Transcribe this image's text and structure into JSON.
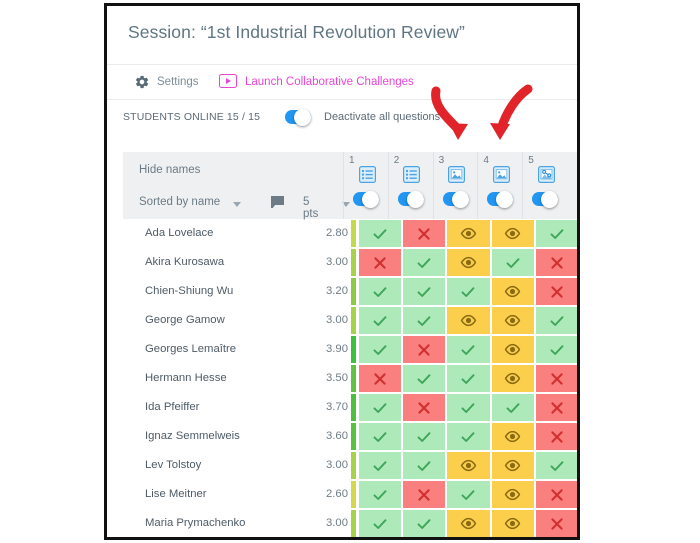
{
  "panel": {
    "title": "Session: “1st Industrial Revolution Review”",
    "accent_magenta": "#e846d6",
    "accent_blue": "#2196f3",
    "border_color": "#111111"
  },
  "actions": {
    "settings_label": "Settings",
    "settings_icon": "gear-icon",
    "launch_label": "Launch Collaborative Challenges",
    "launch_icon": "video-play-icon"
  },
  "status_bar": {
    "students_online_label": "STUDENTS ONLINE 15 / 15",
    "deactivate_label": "Deactivate all questions",
    "deactivate_toggle_on": true
  },
  "table_controls": {
    "hide_names_label": "Hide names",
    "sorted_by_label": "Sorted by name",
    "sorted_by_caret": "chevron-down-icon",
    "flag_icon": "flag-icon",
    "points_label": "5 pts",
    "points_caret": "chevron-down-icon"
  },
  "questions": [
    {
      "number": "1",
      "icon": "list-question-icon",
      "toggle_on": true
    },
    {
      "number": "2",
      "icon": "list-question-icon",
      "toggle_on": true
    },
    {
      "number": "3",
      "icon": "image-question-icon",
      "toggle_on": true
    },
    {
      "number": "4",
      "icon": "image-question-icon",
      "toggle_on": true
    },
    {
      "number": "5",
      "icon": "hotspot-question-icon",
      "toggle_on": true
    }
  ],
  "legend": {
    "correct": "check-icon",
    "incorrect": "cross-icon",
    "viewing": "eye-icon",
    "color_correct": "#aeeab9",
    "color_incorrect": "#f9807e",
    "color_viewing": "#fbcf4c"
  },
  "students": [
    {
      "name": "Ada Lovelace",
      "score": "2.80",
      "accent": "#c5d94f",
      "cells": [
        "ok",
        "no",
        "eye",
        "eye",
        "ok"
      ]
    },
    {
      "name": "Akira Kurosawa",
      "score": "3.00",
      "accent": "#a8d24a",
      "cells": [
        "no",
        "ok",
        "eye",
        "ok",
        "no"
      ]
    },
    {
      "name": "Chien-Shiung Wu",
      "score": "3.20",
      "accent": "#8ecb45",
      "cells": [
        "ok",
        "ok",
        "ok",
        "eye",
        "no"
      ]
    },
    {
      "name": "George Gamow",
      "score": "3.00",
      "accent": "#a8d24a",
      "cells": [
        "ok",
        "ok",
        "eye",
        "eye",
        "ok"
      ]
    },
    {
      "name": "Georges Lemaître",
      "score": "3.90",
      "accent": "#3ec13e",
      "cells": [
        "ok",
        "no",
        "ok",
        "eye",
        "ok"
      ]
    },
    {
      "name": "Hermann Hesse",
      "score": "3.50",
      "accent": "#62c341",
      "cells": [
        "no",
        "ok",
        "ok",
        "eye",
        "no"
      ]
    },
    {
      "name": "Ida Pfeiffer",
      "score": "3.70",
      "accent": "#4fbf3f",
      "cells": [
        "ok",
        "no",
        "ok",
        "ok",
        "no"
      ]
    },
    {
      "name": "Ignaz Semmelweis",
      "score": "3.60",
      "accent": "#57c140",
      "cells": [
        "ok",
        "ok",
        "ok",
        "eye",
        "no"
      ]
    },
    {
      "name": "Lev Tolstoy",
      "score": "3.00",
      "accent": "#a8d24a",
      "cells": [
        "ok",
        "ok",
        "eye",
        "eye",
        "ok"
      ]
    },
    {
      "name": "Lise Meitner",
      "score": "2.60",
      "accent": "#d4d84e",
      "cells": [
        "ok",
        "no",
        "ok",
        "eye",
        "no"
      ]
    },
    {
      "name": "Maria Prymachenko",
      "score": "3.00",
      "accent": "#a8d24a",
      "cells": [
        "ok",
        "ok",
        "eye",
        "eye",
        "no"
      ]
    }
  ],
  "annotations": {
    "arrow_color": "#e0242a",
    "arrows": [
      {
        "name": "arrow-pointing-to-question-3"
      },
      {
        "name": "arrow-pointing-to-question-4"
      }
    ]
  }
}
